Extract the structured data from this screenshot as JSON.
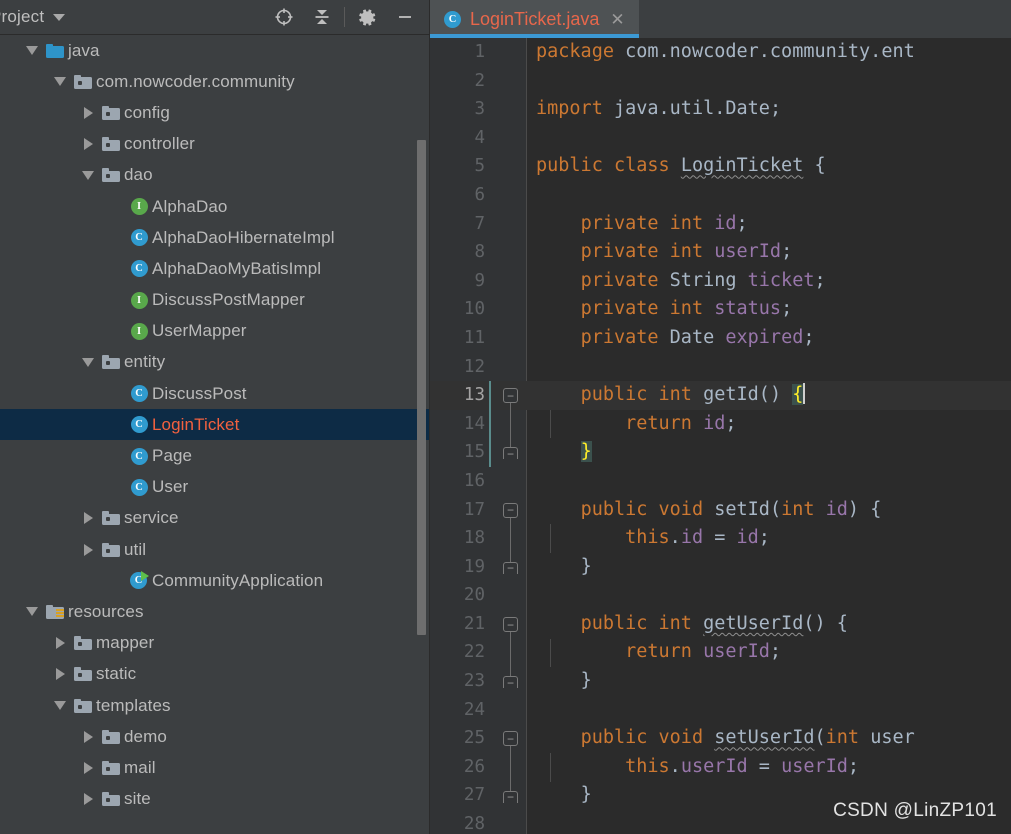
{
  "window": {
    "theme": "darcula",
    "accent_blue": "#3C99D4",
    "selection_bg": "#0D2B45",
    "panel_bg": "#3C3F41",
    "editor_bg": "#2B2B2B"
  },
  "project_panel": {
    "title": "Project",
    "dropdown_icon": "chevron-down-icon",
    "toolbar": [
      {
        "name": "locate-icon",
        "tooltip": "Select Opened File"
      },
      {
        "name": "collapse-all-icon",
        "tooltip": "Collapse All"
      },
      {
        "name": "gear-icon",
        "tooltip": "Settings"
      },
      {
        "name": "minimize-icon",
        "tooltip": "Hide"
      }
    ],
    "tree": [
      {
        "label": "java",
        "icon": "source-folder-icon",
        "state": "expanded",
        "indent": 1
      },
      {
        "label": "com.nowcoder.community",
        "icon": "package-folder-icon",
        "state": "expanded",
        "indent": 2
      },
      {
        "label": "config",
        "icon": "package-folder-icon",
        "state": "collapsed",
        "indent": 3
      },
      {
        "label": "controller",
        "icon": "package-folder-icon",
        "state": "collapsed",
        "indent": 3
      },
      {
        "label": "dao",
        "icon": "package-folder-icon",
        "state": "expanded",
        "indent": 3
      },
      {
        "label": "AlphaDao",
        "icon": "interface-icon",
        "state": "leaf",
        "indent": 4
      },
      {
        "label": "AlphaDaoHibernateImpl",
        "icon": "class-icon",
        "state": "leaf",
        "indent": 4
      },
      {
        "label": "AlphaDaoMyBatisImpl",
        "icon": "class-icon",
        "state": "leaf",
        "indent": 4
      },
      {
        "label": "DiscussPostMapper",
        "icon": "interface-icon",
        "state": "leaf",
        "indent": 4
      },
      {
        "label": "UserMapper",
        "icon": "interface-icon",
        "state": "leaf",
        "indent": 4
      },
      {
        "label": "entity",
        "icon": "package-folder-icon",
        "state": "expanded",
        "indent": 3
      },
      {
        "label": "DiscussPost",
        "icon": "class-icon",
        "state": "leaf",
        "indent": 4
      },
      {
        "label": "LoginTicket",
        "icon": "class-icon",
        "state": "leaf",
        "indent": 4,
        "selected": true
      },
      {
        "label": "Page",
        "icon": "class-icon",
        "state": "leaf",
        "indent": 4
      },
      {
        "label": "User",
        "icon": "class-icon",
        "state": "leaf",
        "indent": 4
      },
      {
        "label": "service",
        "icon": "package-folder-icon",
        "state": "collapsed",
        "indent": 3
      },
      {
        "label": "util",
        "icon": "package-folder-icon",
        "state": "collapsed",
        "indent": 3
      },
      {
        "label": "CommunityApplication",
        "icon": "runnable-class-icon",
        "state": "leaf",
        "indent": 4
      },
      {
        "label": "resources",
        "icon": "resources-folder-icon",
        "state": "expanded",
        "indent": 1
      },
      {
        "label": "mapper",
        "icon": "package-folder-icon",
        "state": "collapsed",
        "indent": 2
      },
      {
        "label": "static",
        "icon": "package-folder-icon",
        "state": "collapsed",
        "indent": 2
      },
      {
        "label": "templates",
        "icon": "package-folder-icon",
        "state": "expanded",
        "indent": 2
      },
      {
        "label": "demo",
        "icon": "package-folder-icon",
        "state": "collapsed",
        "indent": 3
      },
      {
        "label": "mail",
        "icon": "package-folder-icon",
        "state": "collapsed",
        "indent": 3
      },
      {
        "label": "site",
        "icon": "package-folder-icon",
        "state": "collapsed",
        "indent": 3
      }
    ]
  },
  "editor": {
    "tab": {
      "label": "LoginTicket.java",
      "icon": "class-icon",
      "close_icon": "close-icon",
      "active": true
    },
    "cursor_line": 13,
    "lines": [
      {
        "n": "1",
        "text": "package com.nowcoder.community.ent"
      },
      {
        "n": "2",
        "text": ""
      },
      {
        "n": "3",
        "text": "import java.util.Date;"
      },
      {
        "n": "4",
        "text": ""
      },
      {
        "n": "5",
        "text": "public class LoginTicket {"
      },
      {
        "n": "6",
        "text": ""
      },
      {
        "n": "7",
        "text": "    private int id;"
      },
      {
        "n": "8",
        "text": "    private int userId;"
      },
      {
        "n": "9",
        "text": "    private String ticket;"
      },
      {
        "n": "10",
        "text": "    private int status;"
      },
      {
        "n": "11",
        "text": "    private Date expired;"
      },
      {
        "n": "12",
        "text": ""
      },
      {
        "n": "13",
        "text": "    public int getId() {"
      },
      {
        "n": "14",
        "text": "        return id;"
      },
      {
        "n": "15",
        "text": "    }"
      },
      {
        "n": "16",
        "text": ""
      },
      {
        "n": "17",
        "text": "    public void setId(int id) {"
      },
      {
        "n": "18",
        "text": "        this.id = id;"
      },
      {
        "n": "19",
        "text": "    }"
      },
      {
        "n": "20",
        "text": ""
      },
      {
        "n": "21",
        "text": "    public int getUserId() {"
      },
      {
        "n": "22",
        "text": "        return userId;"
      },
      {
        "n": "23",
        "text": "    }"
      },
      {
        "n": "24",
        "text": ""
      },
      {
        "n": "25",
        "text": "    public void setUserId(int user"
      },
      {
        "n": "26",
        "text": "        this.userId = userId;"
      },
      {
        "n": "27",
        "text": "    }"
      },
      {
        "n": "28",
        "text": ""
      }
    ]
  },
  "watermark": {
    "text": "CSDN @LinZP101"
  }
}
